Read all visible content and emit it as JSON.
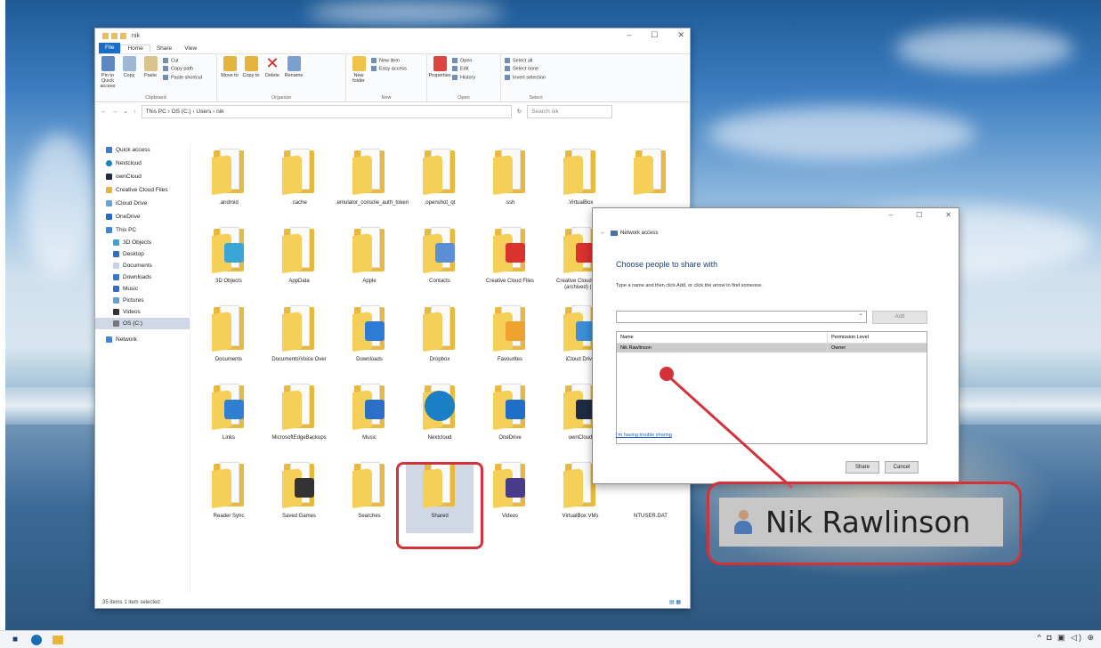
{
  "explorer": {
    "title": "nik",
    "window_controls": [
      "–",
      "☐",
      "✕"
    ],
    "tabs": [
      "File",
      "Home",
      "Share",
      "View"
    ],
    "ribbon": {
      "clipboard": {
        "pin": "Pin to Quick access",
        "copy": "Copy",
        "paste": "Paste",
        "cut": "Cut",
        "copy_path": "Copy path",
        "paste_shortcut": "Paste shortcut",
        "label": "Clipboard"
      },
      "organize": {
        "move_to": "Move to",
        "copy_to": "Copy to",
        "delete": "Delete",
        "rename": "Rename",
        "label": "Organize"
      },
      "new": {
        "new_folder": "New folder",
        "new_item": "New item",
        "easy_access": "Easy access",
        "label": "New"
      },
      "open": {
        "properties": "Properties",
        "open": "Open",
        "edit": "Edit",
        "history": "History",
        "label": "Open"
      },
      "select": {
        "select_all": "Select all",
        "select_none": "Select none",
        "invert": "Invert selection",
        "label": "Select"
      }
    },
    "address": "This PC › OS (C:) › Users › nik",
    "search_placeholder": "Search nik",
    "nav": {
      "quick_access": "Quick access",
      "nextcloud": "Nextcloud",
      "owncloud": "ownCloud",
      "creative_cloud": "Creative Cloud Files",
      "icloud": "iCloud Drive",
      "onedrive": "OneDrive",
      "this_pc": "This PC",
      "objects3d": "3D Objects",
      "desktop": "Desktop",
      "documents": "Documents",
      "downloads": "Downloads",
      "music": "Music",
      "pictures": "Pictures",
      "videos": "Videos",
      "osc": "OS (C:)",
      "network": "Network"
    },
    "items": [
      {
        "name": ".android",
        "color": "#f5cc55"
      },
      {
        "name": ".cache",
        "color": "#f5cc55"
      },
      {
        "name": ".emulator_console_auth_token",
        "color": "#f5cc55"
      },
      {
        "name": ".openshot_qt",
        "color": "#f5cc55"
      },
      {
        "name": ".ssh",
        "color": "#f5cc55"
      },
      {
        "name": ".VirtualBox",
        "color": "#f5cc55"
      },
      {
        "name": "",
        "color": "#f5cc55"
      },
      {
        "name": "3D Objects",
        "color": "#3aa6d8"
      },
      {
        "name": "AppData",
        "color": "#f5cc55"
      },
      {
        "name": "Apple",
        "color": "#f5cc55"
      },
      {
        "name": "Contacts",
        "color": "#5b8ed6"
      },
      {
        "name": "Creative Cloud Files",
        "color": "#d9322f"
      },
      {
        "name": "Creative Cloud Files (archived) (1)",
        "color": "#d9322f"
      },
      {
        "name": "",
        "color": "#f5cc55"
      },
      {
        "name": "Documents",
        "color": "#f5cc55"
      },
      {
        "name": "Documents\\Voice Over",
        "color": "#f5cc55"
      },
      {
        "name": "Downloads",
        "color": "#2d7bd6"
      },
      {
        "name": "Dropbox",
        "color": "#f5cc55"
      },
      {
        "name": "Favourites",
        "color": "#f0a22e"
      },
      {
        "name": "iCloud Drive",
        "color": "#3c8fd8"
      },
      {
        "name": "",
        "color": "#f5cc55"
      },
      {
        "name": "Links",
        "color": "#2f7fd2"
      },
      {
        "name": "MicrosoftEdgeBackups",
        "color": "#f5cc55"
      },
      {
        "name": "Music",
        "color": "#2b6fc8"
      },
      {
        "name": "Nextcloud",
        "color": "#1a7fc4"
      },
      {
        "name": "OneDrive",
        "color": "#1f6fc6"
      },
      {
        "name": "ownCloud",
        "color": "#1d2c44"
      },
      {
        "name": "",
        "color": "#f5cc55"
      },
      {
        "name": "Reader Sync",
        "color": "#f5cc55"
      },
      {
        "name": "Saved Games",
        "color": "#333333"
      },
      {
        "name": "Searches",
        "color": "#f5cc55"
      },
      {
        "name": "Shared",
        "color": "#f5cc55"
      },
      {
        "name": "Videos",
        "color": "#4a3a8a"
      },
      {
        "name": "VirtualBox VMs",
        "color": "#f5cc55"
      },
      {
        "name": "NTUSER.DAT",
        "color": "#ffffff"
      }
    ],
    "status": "35 items    1 item selected"
  },
  "dialog": {
    "title": "Network access",
    "window_controls": [
      "–",
      "☐",
      "✕"
    ],
    "heading": "Choose people to share with",
    "subtext": "Type a name and then click Add, or click the arrow to find someone.",
    "input_value": "",
    "add_label": "Add",
    "columns": [
      "Name",
      "Permission Level"
    ],
    "rows": [
      {
        "name": "Nik Rawlinson",
        "level": "Owner"
      }
    ],
    "trouble_link": "I'm having trouble sharing",
    "share_label": "Share",
    "cancel_label": "Cancel"
  },
  "callout": {
    "name": "Nik Rawlinson"
  },
  "taskbar": {
    "tray": "^ ◘ ▣ ◁) ⊕"
  }
}
